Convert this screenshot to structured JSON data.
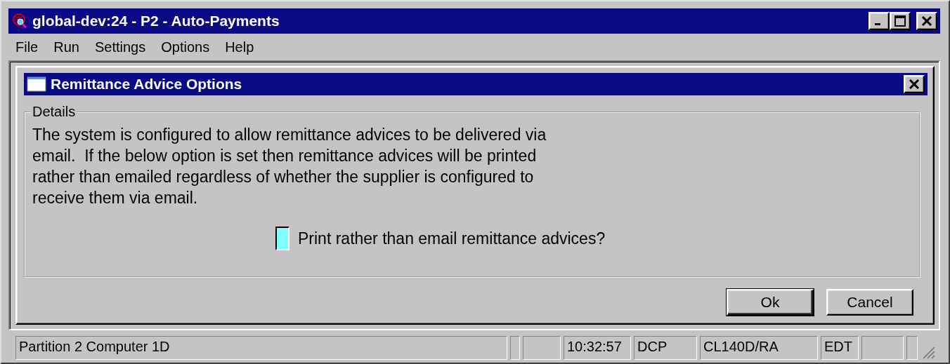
{
  "window": {
    "title": "global-dev:24 - P2 - Auto-Payments"
  },
  "menu": [
    "File",
    "Run",
    "Settings",
    "Options",
    "Help"
  ],
  "dialog": {
    "title": "Remittance Advice Options",
    "group": {
      "title": "Details",
      "paragraph_lines": [
        "The system is configured to allow remittance advices to be delivered via",
        "email.  If the below option is set then remittance advices will be printed",
        "rather than emailed regardless of whether the supplier is configured to",
        "receive them via email."
      ],
      "checkbox": {
        "label": "Print rather than email remittance advices?",
        "checked": false
      }
    },
    "buttons": [
      {
        "label": "Ok",
        "default": true
      },
      {
        "label": "Cancel",
        "default": false
      }
    ]
  },
  "status_bar": {
    "message": "Partition 2 Computer 1D",
    "time": "10:32:57",
    "mode": "DCP",
    "program": "CL140D/RA",
    "edit_mode": "EDT"
  }
}
